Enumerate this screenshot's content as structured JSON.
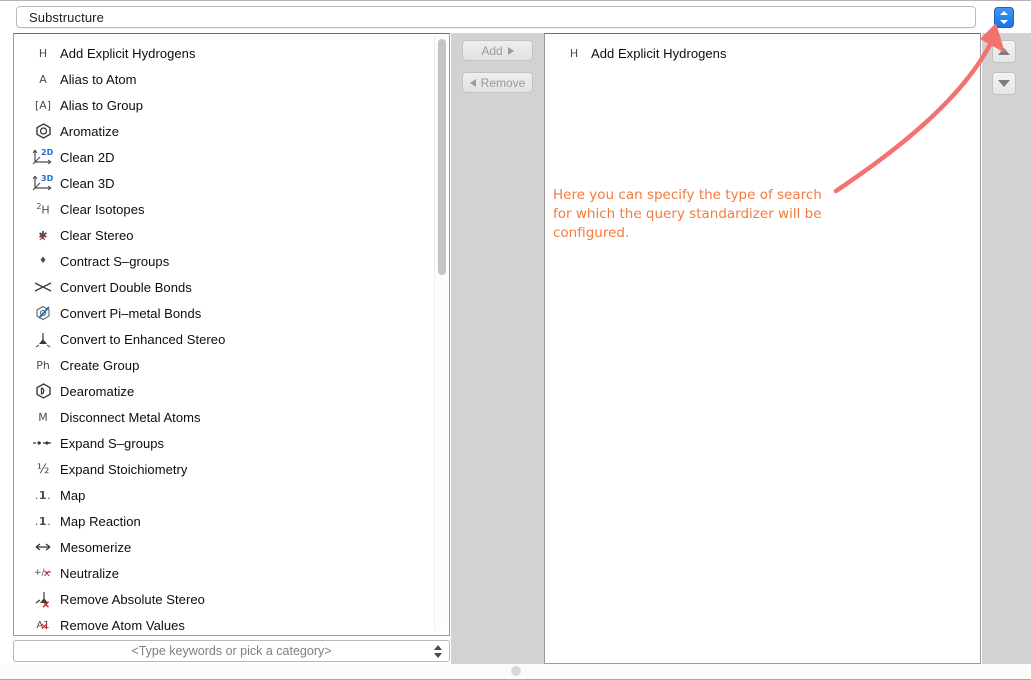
{
  "window": {
    "title_field_value": "Substructure",
    "accent_blue": "#1a73e8",
    "panel_grey": "#d2d2d2"
  },
  "top_bar": {
    "category_combo": {
      "name": "search-type-combo",
      "value": "Substructure"
    },
    "type_stepper": {
      "name": "search-type-stepper",
      "up_glyph": "▲",
      "down_glyph": "▼"
    }
  },
  "available_actions": {
    "panel_name": "available-actions-list",
    "items": [
      {
        "icon": "hydrogen-icon",
        "icon_text": "H",
        "label": "Add Explicit Hydrogens"
      },
      {
        "icon": "alias-atom-icon",
        "icon_text": "A",
        "label": "Alias to Atom"
      },
      {
        "icon": "alias-group-icon",
        "icon_text": "[A]",
        "label": "Alias to Group"
      },
      {
        "icon": "aromatize-icon",
        "icon_text": "",
        "label": "Aromatize"
      },
      {
        "icon": "clean-2d-icon",
        "icon_text": "2D",
        "label": "Clean 2D"
      },
      {
        "icon": "clean-3d-icon",
        "icon_text": "3D",
        "label": "Clean 3D"
      },
      {
        "icon": "clear-isotopes-icon",
        "icon_text": "2H",
        "label": "Clear Isotopes"
      },
      {
        "icon": "clear-stereo-icon",
        "icon_text": "*",
        "label": "Clear Stereo"
      },
      {
        "icon": "contract-sgroups-icon",
        "icon_text": "•",
        "label": "Contract S–groups"
      },
      {
        "icon": "convert-double-bonds-icon",
        "icon_text": "✕",
        "label": "Convert Double Bonds"
      },
      {
        "icon": "convert-pi-metal-bonds-icon",
        "icon_text": "",
        "label": "Convert Pi–metal Bonds"
      },
      {
        "icon": "convert-enhanced-stereo-icon",
        "icon_text": "",
        "label": "Convert to Enhanced Stereo"
      },
      {
        "icon": "create-group-icon",
        "icon_text": "Ph",
        "label": "Create Group"
      },
      {
        "icon": "dearomatize-icon",
        "icon_text": "",
        "label": "Dearomatize"
      },
      {
        "icon": "disconnect-metal-atoms-icon",
        "icon_text": "M",
        "label": "Disconnect Metal Atoms"
      },
      {
        "icon": "expand-sgroups-icon",
        "icon_text": "↔",
        "label": "Expand S–groups"
      },
      {
        "icon": "expand-stoichiometry-icon",
        "icon_text": "½",
        "label": "Expand Stoichiometry"
      },
      {
        "icon": "map-icon",
        "icon_text": ".1.",
        "label": "Map"
      },
      {
        "icon": "map-reaction-icon",
        "icon_text": ".1.",
        "label": "Map Reaction"
      },
      {
        "icon": "mesomerize-icon",
        "icon_text": "⟷",
        "label": "Mesomerize"
      },
      {
        "icon": "neutralize-icon",
        "icon_text": "+/–",
        "label": "Neutralize"
      },
      {
        "icon": "remove-absolute-stereo-icon",
        "icon_text": "",
        "label": "Remove Absolute Stereo"
      },
      {
        "icon": "remove-atom-values-icon",
        "icon_text": "A1",
        "label": "Remove Atom Values"
      }
    ]
  },
  "keyword_field": {
    "name": "keyword-search-field",
    "placeholder": "<Type keywords or pick a category>",
    "value": "<Type keywords or pick a category>"
  },
  "transfer_buttons": {
    "add": {
      "label": "Add",
      "enabled": false
    },
    "remove": {
      "label": "Remove",
      "enabled": false
    }
  },
  "selected_actions": {
    "panel_name": "selected-actions-list",
    "items": [
      {
        "icon": "hydrogen-icon",
        "icon_text": "H",
        "label": "Add Explicit Hydrogens"
      }
    ]
  },
  "order_buttons": {
    "move_up": {
      "name": "scroll-up-button",
      "glyph": "▲"
    },
    "move_down": {
      "name": "scroll-down-button",
      "glyph": "▼"
    }
  },
  "annotation": {
    "text": "Here you can specify the type of search\nfor which the query standardizer will be\nconfigured.",
    "text_color": "#f47b3c",
    "arrow_color": "#f4726e"
  }
}
